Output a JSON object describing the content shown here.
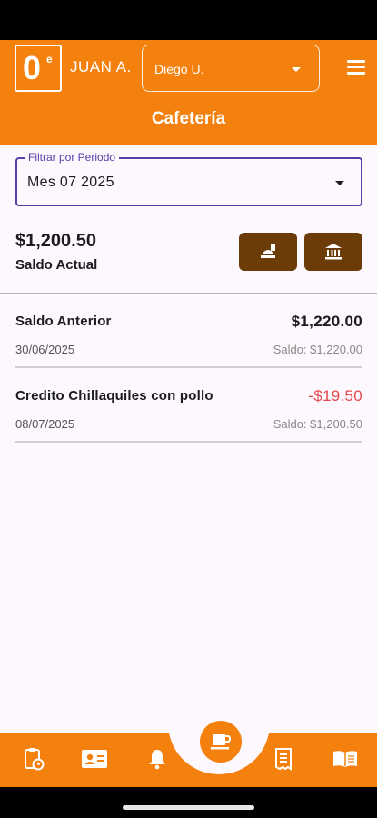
{
  "header": {
    "logo_text": "0",
    "logo_superscript": "e",
    "user_name": "JUAN A.",
    "student_selector": {
      "value": "Diego U."
    },
    "title": "Cafetería"
  },
  "filter": {
    "label": "Filtrar por Periodo",
    "value": "Mes 07 2025"
  },
  "balance": {
    "amount": "$1,200.50",
    "label": "Saldo Actual"
  },
  "actions": [
    {
      "icon": "cutlery-plate-icon"
    },
    {
      "icon": "bank-icon"
    }
  ],
  "transactions": [
    {
      "description": "Saldo Anterior",
      "amount": "$1,220.00",
      "date": "30/06/2025",
      "balance": "Saldo: $1,220.00"
    },
    {
      "description": "Credito Chillaquiles con pollo",
      "amount": "-$19.50",
      "date": "08/07/2025",
      "balance": "Saldo: $1,200.50"
    }
  ],
  "bottom_nav": [
    {
      "icon": "clipboard-clock-icon"
    },
    {
      "icon": "contact-card-icon"
    },
    {
      "icon": "bell-icon"
    },
    {
      "icon": "coffee-cup-icon",
      "active": true
    },
    {
      "icon": "receipt-icon"
    },
    {
      "icon": "open-book-icon"
    }
  ],
  "colors": {
    "primary": "#F4810E",
    "action_button": "#6B3B08",
    "negative_amount": "#E5484D",
    "focus_outline": "#5A3DA8",
    "background": "#FDF8FD"
  }
}
